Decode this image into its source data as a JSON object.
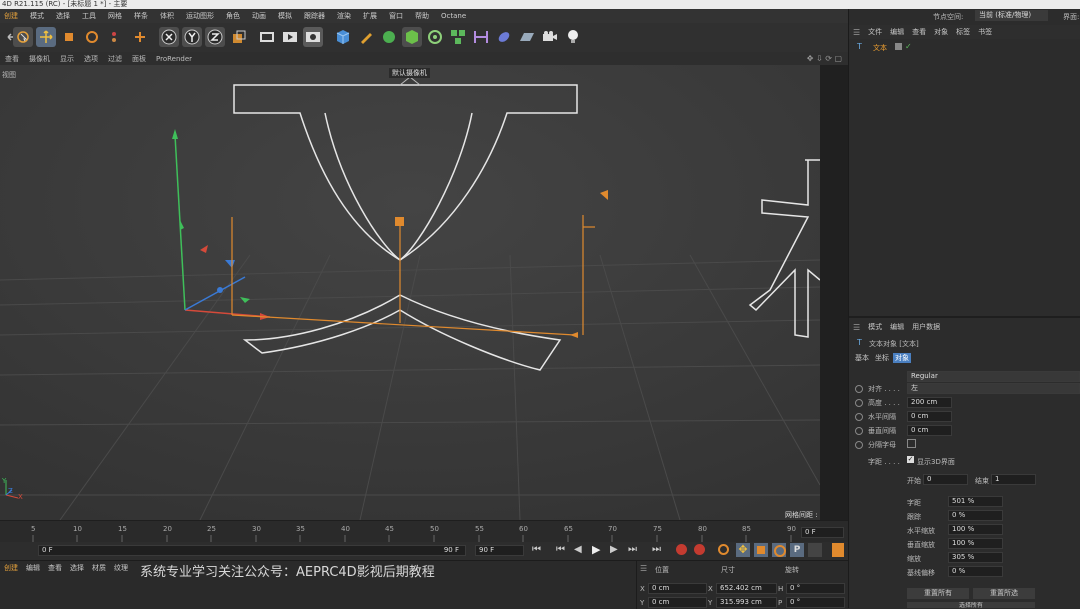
{
  "title_bar": "4D R21.115 (RC) - [未标题 1 *] - 主要",
  "menus": [
    "创建",
    "模式",
    "选择",
    "工具",
    "网格",
    "样条",
    "体积",
    "运动图形",
    "角色",
    "动画",
    "模拟",
    "跟踪器",
    "渲染",
    "扩展",
    "窗口",
    "帮助",
    "Octane"
  ],
  "layout": {
    "label": "节点空间:",
    "value": "当前 (标准/物理)",
    "right_label": "界面:"
  },
  "viewport_menu": [
    "查看",
    "摄像机",
    "显示",
    "选项",
    "过滤",
    "面板",
    "ProRender"
  ],
  "viewport": {
    "label": "视图",
    "camera_tag": "默认摄像机",
    "grid_spacing": "网格间距 : 100 cm",
    "axis_y": "Y",
    "axis_z": "Z",
    "axis_x": "X"
  },
  "timeline": {
    "ticks": [
      "5",
      "10",
      "15",
      "20",
      "25",
      "30",
      "35",
      "40",
      "45",
      "50",
      "55",
      "60",
      "65",
      "70",
      "75",
      "80",
      "85",
      "90"
    ],
    "frame_field": "0 F"
  },
  "transport": {
    "start": "0 F",
    "end": "90 F",
    "end2": "90 F"
  },
  "bottom_menu": [
    "创建",
    "编辑",
    "查看",
    "选择",
    "材质",
    "纹理"
  ],
  "watermark": "系统专业学习关注公众号：AEPRC4D影视后期教程",
  "coords": {
    "headers": [
      "位置",
      "尺寸",
      "旋转"
    ],
    "rows": [
      {
        "axis": "X",
        "pos": "0 cm",
        "size_axis": "X",
        "size": "652.402 cm",
        "rot_axis": "H",
        "rot": "0 °"
      },
      {
        "axis": "Y",
        "pos": "0 cm",
        "size_axis": "Y",
        "size": "315.993 cm",
        "rot_axis": "P",
        "rot": "0 °"
      }
    ]
  },
  "object_manager": {
    "menus": [
      "文件",
      "编辑",
      "查看",
      "对象",
      "标签",
      "书签"
    ],
    "object_name": "文本"
  },
  "attributes": {
    "menus": [
      "模式",
      "编辑",
      "用户数据"
    ],
    "object_title": "文本对象 [文本]",
    "tabs": [
      "基本",
      "坐标",
      "对象"
    ],
    "font_style": "Regular",
    "params": [
      {
        "label": "对齐 . . . .",
        "value": "左"
      },
      {
        "label": "高度 . . . .",
        "value": "200 cm"
      },
      {
        "label": "水平间隔",
        "value": "0 cm"
      },
      {
        "label": "垂直间隔",
        "value": "0 cm"
      },
      {
        "label": "分隔字母",
        "value": ""
      }
    ],
    "kerning_label": "字距 . . . .",
    "show3d": "显示3D界面",
    "start_label": "开始",
    "start_value": "0",
    "end_label": "结束",
    "end_value": "1",
    "kparams": [
      {
        "label": "字距",
        "value": "501 %"
      },
      {
        "label": "跟踪",
        "value": "0 %"
      },
      {
        "label": "水平缩放",
        "value": "100 %"
      },
      {
        "label": "垂直缩放",
        "value": "100 %"
      },
      {
        "label": "缩放",
        "value": "305 %"
      },
      {
        "label": "基线偏移",
        "value": "0 %"
      }
    ],
    "buttons": [
      "重置所有",
      "重置所选",
      "选择所有"
    ]
  }
}
